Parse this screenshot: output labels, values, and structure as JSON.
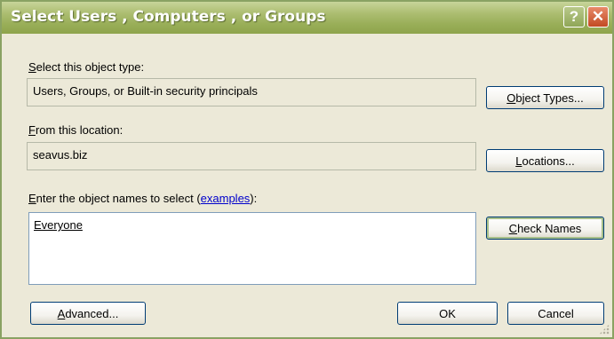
{
  "window": {
    "title": "Select Users , Computers , or Groups",
    "help_glyph": "?",
    "close_glyph": "✕"
  },
  "object_type": {
    "label_accel": "S",
    "label_rest": "elect this object type:",
    "value": "Users, Groups, or Built-in security principals",
    "button_accel": "O",
    "button_rest": "bject Types..."
  },
  "location": {
    "label_accel": "F",
    "label_rest": "rom this location:",
    "value": "seavus.biz",
    "button_accel": "L",
    "button_rest": "ocations..."
  },
  "names": {
    "label_accel": "E",
    "label_rest": "nter the object names to select (",
    "label_link": "examples",
    "label_end": "):",
    "value": "Everyone",
    "check_accel": "C",
    "check_rest": "heck Names"
  },
  "footer": {
    "advanced_accel": "A",
    "advanced_rest": "dvanced...",
    "ok_label": "OK",
    "cancel_label": "Cancel"
  }
}
